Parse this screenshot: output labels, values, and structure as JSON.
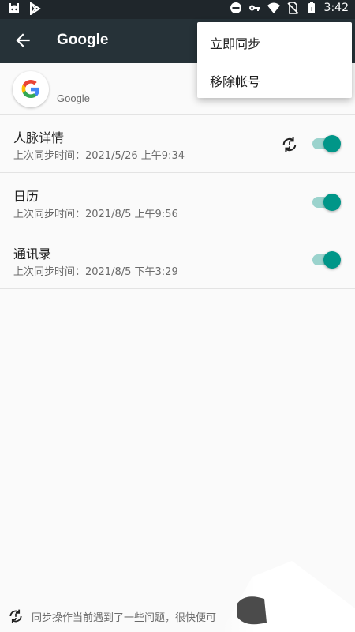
{
  "status_bar": {
    "time": "3:42"
  },
  "toolbar": {
    "title": "Google"
  },
  "account": {
    "name": "Google"
  },
  "sync_items": [
    {
      "title": "人脉详情",
      "subtitle": "上次同步时间：2021/5/26 上午9:34",
      "enabled": true,
      "has_error_icon": true
    },
    {
      "title": "日历",
      "subtitle": "上次同步时间：2021/8/5 上午9:56",
      "enabled": true,
      "has_error_icon": false
    },
    {
      "title": "通讯录",
      "subtitle": "上次同步时间：2021/8/5 下午3:29",
      "enabled": true,
      "has_error_icon": false
    }
  ],
  "menu": {
    "items": [
      "立即同步",
      "移除帐号"
    ]
  },
  "footer": {
    "message": "同步操作当前遇到了一些问题，很快便可"
  },
  "colors": {
    "toolbar": "#263238",
    "status_bar": "#1f262b",
    "accent": "#009688",
    "track": "#9bd3cd"
  },
  "icons": [
    "android-icon",
    "play-store-icon",
    "do-not-disturb-icon",
    "vpn-key-icon",
    "wifi-icon",
    "no-sim-icon",
    "battery-icon",
    "back-arrow-icon",
    "google-logo-icon",
    "sync-problem-icon"
  ]
}
